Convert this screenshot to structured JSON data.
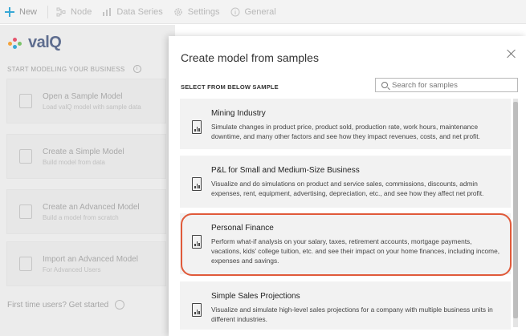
{
  "toolbar": {
    "new_label": "New",
    "node_label": "Node",
    "data_series_label": "Data Series",
    "settings_label": "Settings",
    "general_label": "General"
  },
  "brand": {
    "logo_text": "valQ"
  },
  "left_panel": {
    "section_title": "START MODELING YOUR BUSINESS",
    "cards": [
      {
        "title": "Open a Sample Model",
        "subtitle": "Load valQ model with sample data",
        "icon": "chart-document-icon"
      },
      {
        "title": "Create a Simple Model",
        "subtitle": "Build model from data",
        "icon": "blocks-icon"
      },
      {
        "title": "Create an Advanced Model",
        "subtitle": "Build a model from scratch",
        "icon": "new-document-icon"
      },
      {
        "title": "Import an Advanced Model",
        "subtitle": "For Advanced Users",
        "icon": "import-document-icon"
      }
    ],
    "first_time_label": "First time users? Get started"
  },
  "modal": {
    "title": "Create model from samples",
    "select_label": "SELECT FROM BELOW SAMPLE",
    "search_placeholder": "Search for samples",
    "items": [
      {
        "title": "Mining Industry",
        "desc": "Simulate changes in product price, product sold, production rate, work hours, maintenance downtime, and many other factors and see how they impact revenues, costs, and net profit."
      },
      {
        "title": "P&L for Small and Medium-Size Business",
        "desc": "Visualize and do simulations on product and service sales, commissions, discounts, admin expenses, rent, equipment, advertising, depreciation, etc., and see how they affect net profit."
      },
      {
        "title": "Personal Finance",
        "desc": "Perform what-if analysis on your salary, taxes, retirement accounts, mortgage payments, vacations, kids' college tuition, etc. and see their impact on your home finances, including income, expenses and savings."
      },
      {
        "title": "Simple Sales Projections",
        "desc": "Visualize and simulate high-level sales projections for a company with multiple business units in different industries."
      }
    ]
  },
  "colors": {
    "accent": "#39a8d6",
    "highlight": "#e05a3a",
    "logo": "#5e6d8f"
  }
}
